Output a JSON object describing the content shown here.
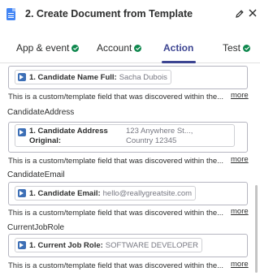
{
  "header": {
    "title": "2. Create Document from Template"
  },
  "tabs": [
    {
      "label": "App & event"
    },
    {
      "label": "Account"
    },
    {
      "label": "Action"
    },
    {
      "label": "Test"
    }
  ],
  "fields": [
    {
      "pill_label": "1. Candidate Name Full:",
      "pill_value": "Sacha Dubois",
      "help": "This is a custom/template field that was discovered within the...",
      "more": "more"
    },
    {
      "label": "CandidateAddress",
      "pill_label": "1. Candidate Address Original:",
      "pill_value": "123 Anywhere St..., Country 12345",
      "help": "This is a custom/template field that was discovered within the...",
      "more": "more"
    },
    {
      "label": "CandidateEmail",
      "pill_label": "1. Candidate Email:",
      "pill_value": "hello@reallygreatsite.com",
      "help": "This is a custom/template field that was discovered within the...",
      "more": "more"
    },
    {
      "label": "CurrentJobRole",
      "pill_label": "1. Current Job Role:",
      "pill_value": "SOFTWARE DEVELOPER",
      "help": "This is a custom/template field that was discovered within the...",
      "more": "more"
    }
  ],
  "colors": {
    "accent": "#3d4592",
    "success": "#0f884e",
    "doc_icon": "#4285f4"
  },
  "icons": {
    "app": "google-docs-icon",
    "edit": "pencil-icon",
    "close": "close-icon",
    "status": "check-circle-icon",
    "pill": "zapier-step-icon"
  }
}
